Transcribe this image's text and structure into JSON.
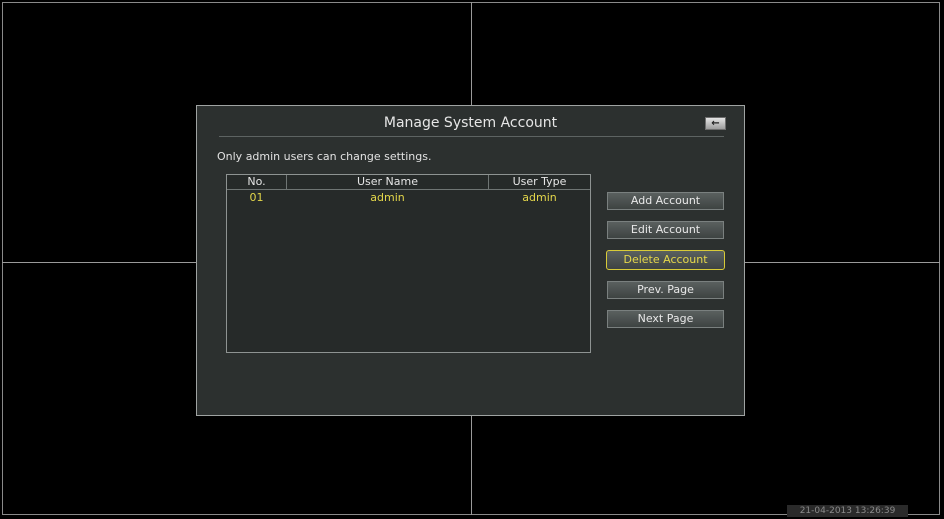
{
  "dialog": {
    "title": "Manage System Account",
    "back_icon": "←",
    "notice": "Only admin users can change settings."
  },
  "table": {
    "columns": [
      "No.",
      "User Name",
      "User Type"
    ],
    "rows": [
      {
        "no": "01",
        "user_name": "admin",
        "user_type": "admin"
      }
    ]
  },
  "buttons": {
    "add": "Add Account",
    "edit": "Edit Account",
    "delete": "Delete Account",
    "prev": "Prev. Page",
    "next": "Next Page"
  },
  "status": {
    "datetime": "21-04-2013 13:26:39"
  },
  "colors": {
    "accent_yellow": "#e3d64a",
    "dialog_bg": "#2c302f"
  }
}
